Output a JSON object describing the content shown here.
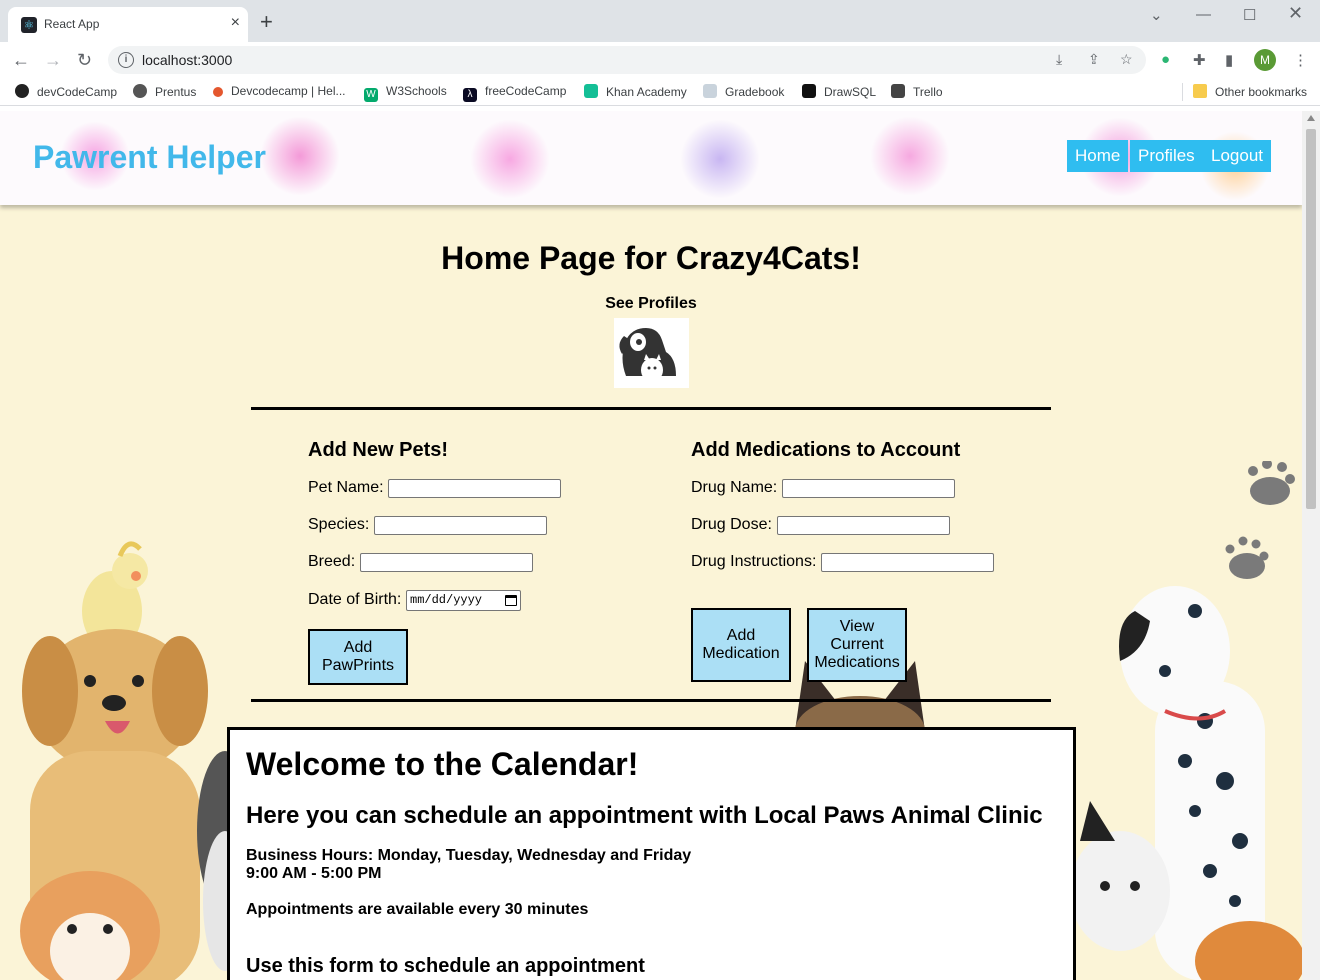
{
  "browser": {
    "tab_title": "React App",
    "url": "localhost:3000",
    "profile_initial": "M",
    "bookmarks": [
      "devCodeCamp",
      "Prentus",
      "Devcodecamp | Hel...",
      "W3Schools",
      "freeCodeCamp",
      "Khan Academy",
      "Gradebook",
      "DrawSQL",
      "Trello"
    ],
    "other_bookmarks": "Other bookmarks"
  },
  "header": {
    "brand": "Pawrent Helper",
    "nav": [
      "Home",
      "Profiles",
      "Logout"
    ]
  },
  "main": {
    "title": "Home Page for Crazy4Cats!",
    "see_profiles": "See Profiles"
  },
  "pets_form": {
    "title": "Add New Pets!",
    "pet_name_label": "Pet Name:",
    "species_label": "Species:",
    "breed_label": "Breed:",
    "dob_label": "Date of Birth:",
    "dob_placeholder": "mm/dd/yyyy",
    "submit_label": "Add\nPawPrints"
  },
  "meds_form": {
    "title": "Add Medications to Account",
    "drug_name_label": "Drug Name:",
    "drug_dose_label": "Drug Dose:",
    "drug_instructions_label": "Drug Instructions:",
    "add_label": "Add\nMedication",
    "view_label": "View\nCurrent\nMedications"
  },
  "calendar": {
    "title": "Welcome to the Calendar!",
    "subtitle": "Here you can schedule an appointment with Local Paws Animal Clinic",
    "hours_line1": "Business Hours: Monday, Tuesday, Wednesday and Friday",
    "hours_line2": "9:00 AM - 5:00 PM",
    "availability": "Appointments are available every 30 minutes",
    "form_title": "Use this form to schedule an appointment"
  },
  "colors": {
    "brand": "#42b8ea",
    "nav_bg": "#2fbdf0",
    "button_bg": "#abdff5",
    "page_bg": "#fbf4d7"
  }
}
